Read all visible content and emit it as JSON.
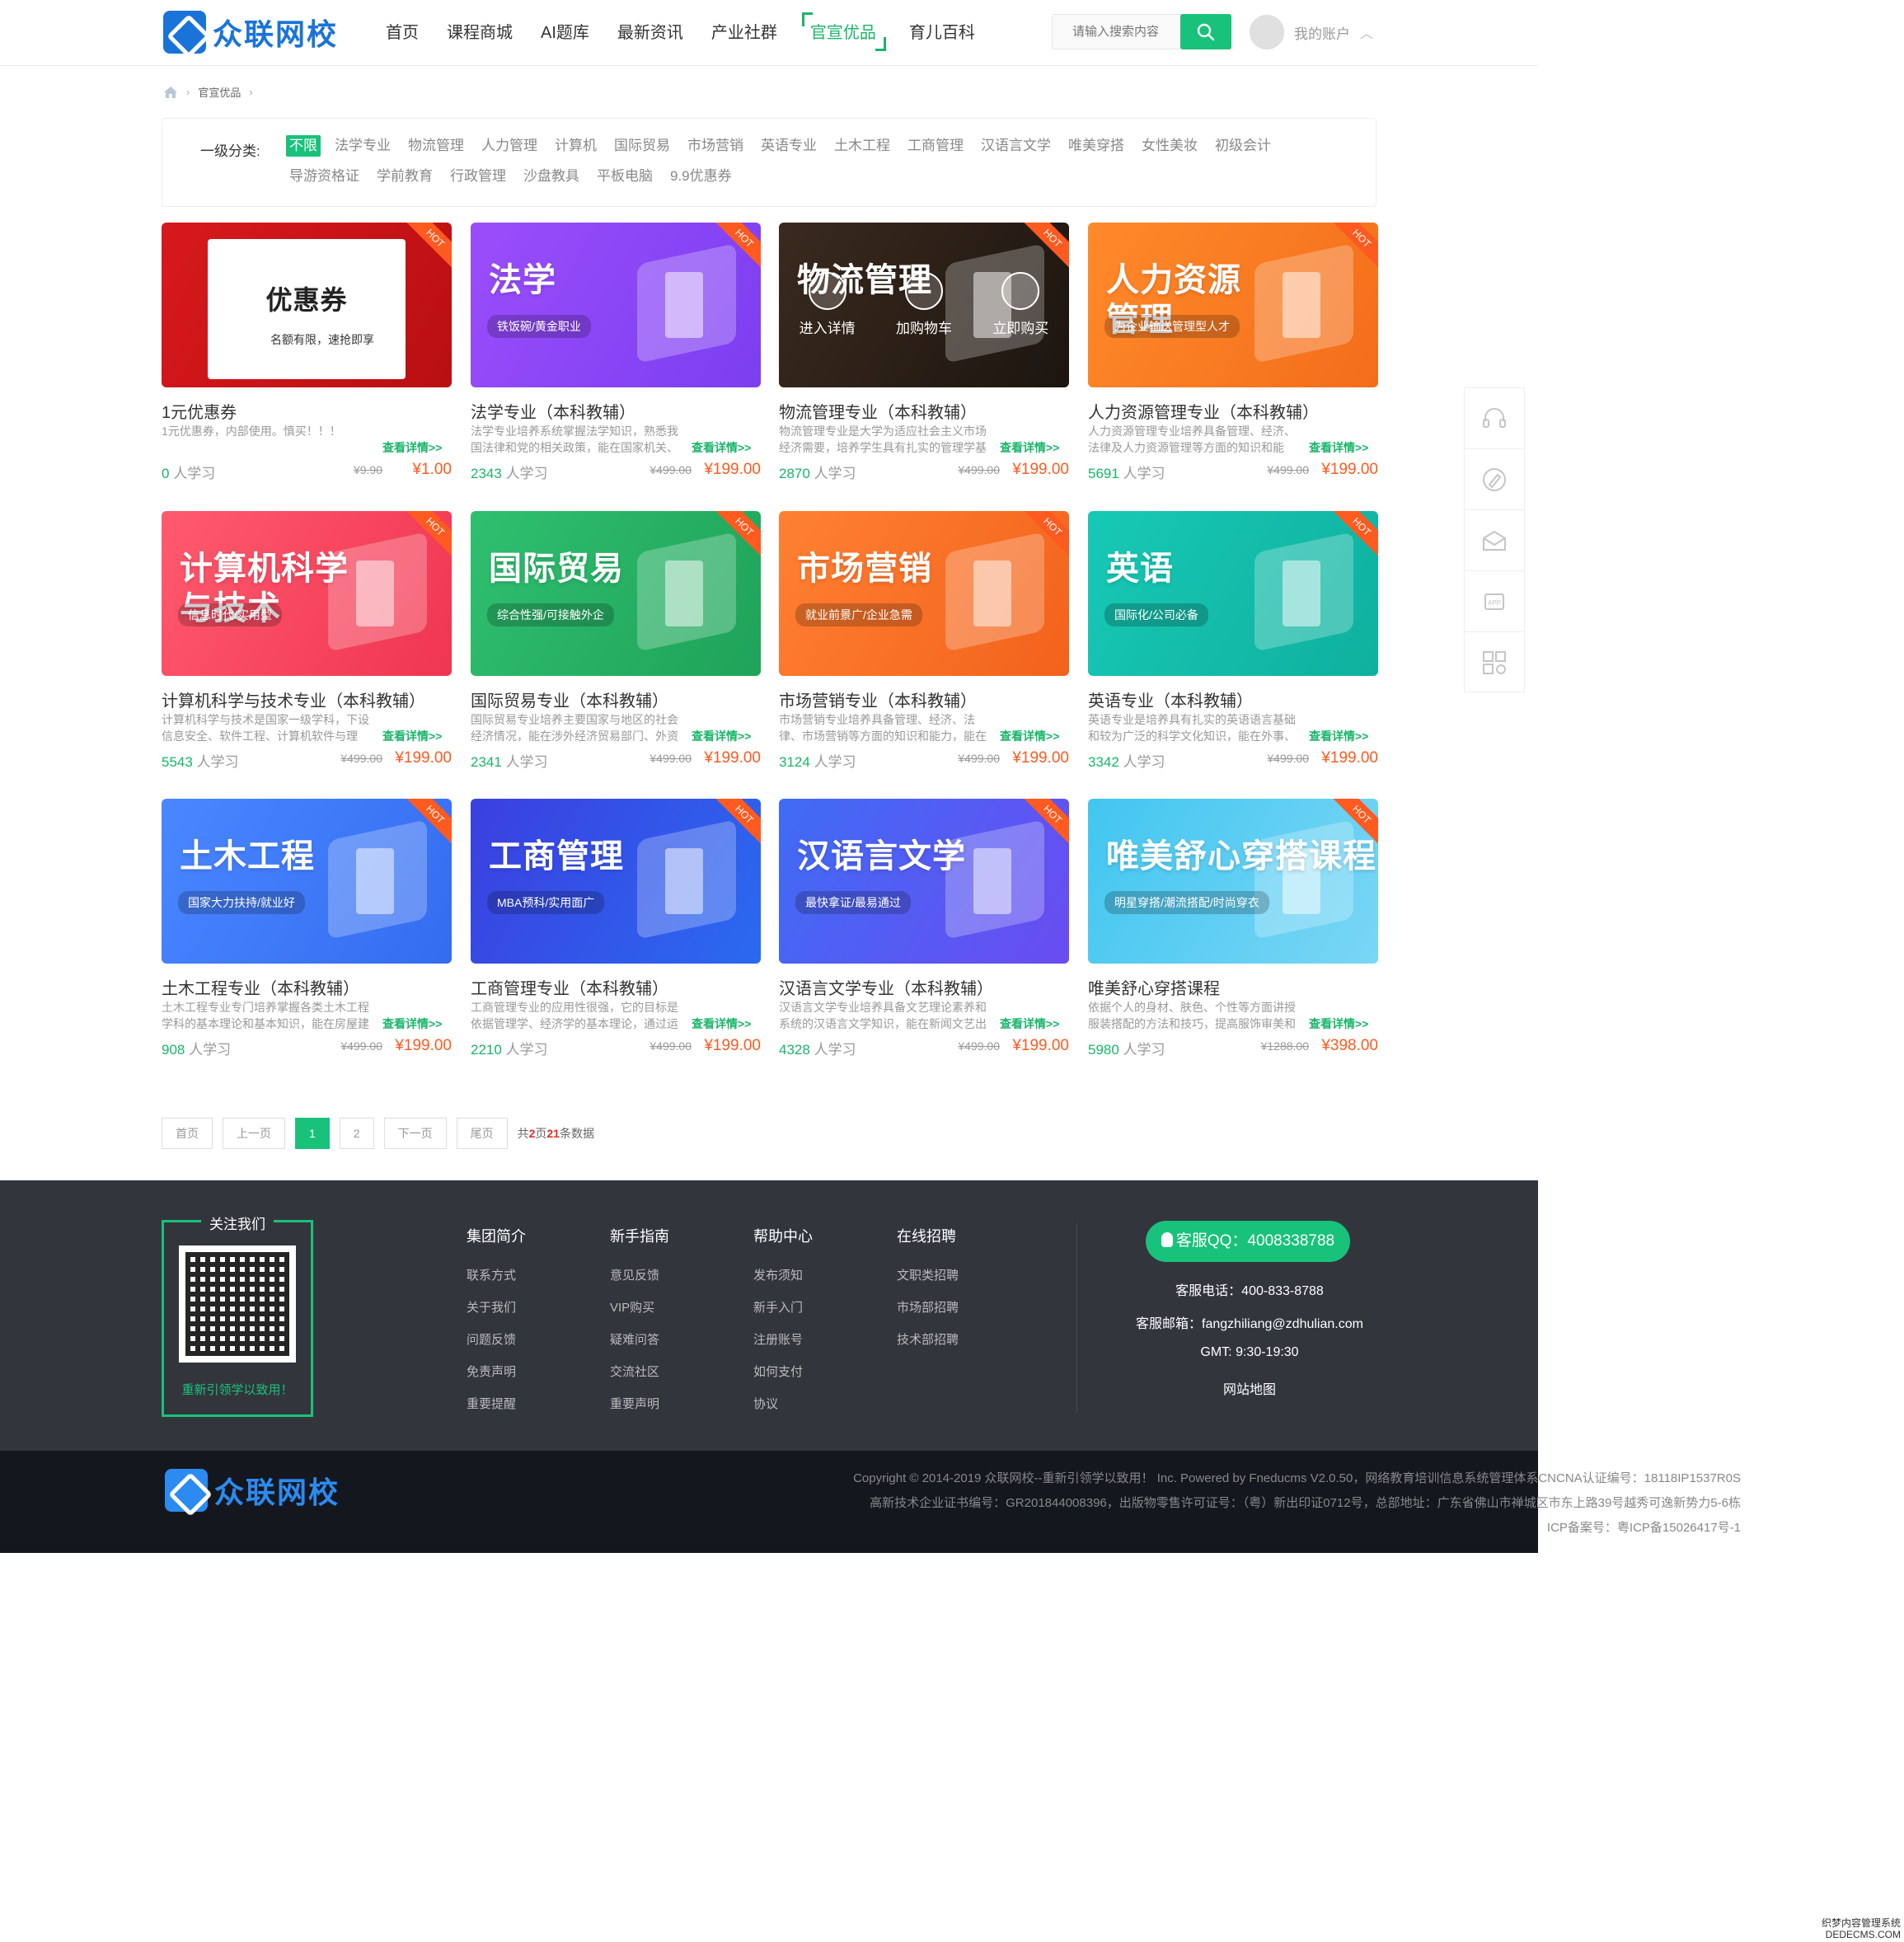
{
  "header": {
    "logo_text": "众联网校",
    "nav": [
      "首页",
      "课程商城",
      "AI题库",
      "最新资讯",
      "产业社群",
      "官宣优品",
      "育儿百科"
    ],
    "search_placeholder": "请输入搜索内容",
    "account_label": "我的账户"
  },
  "breadcrumb": {
    "current": "官宣优品"
  },
  "filter": {
    "label": "一级分类:",
    "tags": [
      "不限",
      "法学专业",
      "物流管理",
      "人力管理",
      "计算机",
      "国际贸易",
      "市场营销",
      "英语专业",
      "土木工程",
      "工商管理",
      "汉语言文学",
      "唯美穿搭",
      "女性美妆",
      "初级会计",
      "导游资格证",
      "学前教育",
      "行政管理",
      "沙盘教具",
      "平板电脑",
      "9.9优惠券"
    ]
  },
  "courses": [
    {
      "thumb_title": "优惠券",
      "thumb_sub": "名额有限，速抢即享",
      "name": "1元优惠券",
      "desc": "1元优惠券，内部使用。慎买！！！",
      "more": "查看详情>>",
      "count": "0",
      "unit": "人学习",
      "old": "¥9.90",
      "price": "¥1.00",
      "color1": "#d7191c",
      "color2": "#b90f12"
    },
    {
      "thumb_title": "法学",
      "thumb_sub": "铁饭碗/黄金职业",
      "name": "法学专业（本科教辅）",
      "desc": "法学专业培养系统掌握法学知识，熟悉我国法律和党的相关政策，能在国家机关、企事业单",
      "more": "查看详情>>",
      "count": "2343",
      "unit": "人学习",
      "old": "¥499.00",
      "price": "¥199.00",
      "color1": "#9b4dfb",
      "color2": "#7b3ff0"
    },
    {
      "thumb_title": "物流管理",
      "thumb_sub": "",
      "name": "物流管理专业（本科教辅）",
      "desc": "物流管理专业是大学为适应社会主义市场经济需要，培养学生具有扎实的管理学基础、经济",
      "more": "查看详情>>",
      "count": "2870",
      "unit": "人学习",
      "old": "¥499.00",
      "price": "¥199.00",
      "color1": "#3a2a1e",
      "color2": "#1c1510",
      "overlay": [
        "进入详情",
        "加购物车",
        "立即购买"
      ]
    },
    {
      "thumb_title": "人力资源\n管理",
      "thumb_sub": "为企业输送管理型人才",
      "name": "人力资源管理专业（本科教辅）",
      "desc": "人力资源管理专业培养具备管理、经济、法律及人力资源管理等方面的知识和能力，能在事",
      "more": "查看详情>>",
      "count": "5691",
      "unit": "人学习",
      "old": "¥499.00",
      "price": "¥199.00",
      "color1": "#ff8a2a",
      "color2": "#f36d1b"
    },
    {
      "thumb_title": "计算机科学\n与技术",
      "thumb_sub": "信息时代/实用型",
      "name": "计算机科学与技术专业（本科教辅）",
      "desc": "计算机科学与技术是国家一级学科，下设信息安全、软件工程、计算机软件与理论、计算机",
      "more": "查看详情>>",
      "count": "5543",
      "unit": "人学习",
      "old": "¥499.00",
      "price": "¥199.00",
      "color1": "#ff5a6e",
      "color2": "#f03550"
    },
    {
      "thumb_title": "国际贸易",
      "thumb_sub": "综合性强/可接触外企",
      "name": "国际贸易专业（本科教辅）",
      "desc": "国际贸易专业培养主要国家与地区的社会经济情况，能在涉外经济贸易部门、外资企业及政",
      "more": "查看详情>>",
      "count": "2341",
      "unit": "人学习",
      "old": "¥499.00",
      "price": "¥199.00",
      "color1": "#2fbf6f",
      "color2": "#1fa35a"
    },
    {
      "thumb_title": "市场营销",
      "thumb_sub": "就业前景广/企业急需",
      "name": "市场营销专业（本科教辅）",
      "desc": "市场营销专业培养具备管理、经济、法律、市场营销等方面的知识和能力，能在企、事业单",
      "more": "查看详情>>",
      "count": "3124",
      "unit": "人学习",
      "old": "¥499.00",
      "price": "¥199.00",
      "color1": "#ff8032",
      "color2": "#f2621c"
    },
    {
      "thumb_title": "英语",
      "thumb_sub": "国际化/公司必备",
      "name": "英语专业（本科教辅）",
      "desc": "英语专业是培养具有扎实的英语语言基础和较为广泛的科学文化知识，能在外事、经贸、文",
      "more": "查看详情>>",
      "count": "3342",
      "unit": "人学习",
      "old": "¥499.00",
      "price": "¥199.00",
      "color1": "#17c9b5",
      "color2": "#0fb09e"
    },
    {
      "thumb_title": "土木工程",
      "thumb_sub": "国家大力扶持/就业好",
      "name": "土木工程专业（本科教辅）",
      "desc": "土木工程专业专门培养掌握各类土木工程学科的基本理论和基本知识，能在房屋建筑、地下",
      "more": "查看详情>>",
      "count": "908",
      "unit": "人学习",
      "old": "¥499.00",
      "price": "¥199.00",
      "color1": "#4a87ff",
      "color2": "#346cf0"
    },
    {
      "thumb_title": "工商管理",
      "thumb_sub": "MBA预科/实用面广",
      "name": "工商管理专业（本科教辅）",
      "desc": "工商管理专业的应用性很强，它的目标是依据管理学、经济学的基本理论，通过运用现代",
      "more": "查看详情>>",
      "count": "2210",
      "unit": "人学习",
      "old": "¥499.00",
      "price": "¥199.00",
      "color1": "#3b3fe0",
      "color2": "#2a6af0"
    },
    {
      "thumb_title": "汉语言文学",
      "thumb_sub": "最快拿证/最易通过",
      "name": "汉语言文学专业（本科教辅）",
      "desc": "汉语言文学专业培养具备文艺理论素养和系统的汉语言文学知识，能在新闻文艺出版部门、",
      "more": "查看详情>>",
      "count": "4328",
      "unit": "人学习",
      "old": "¥499.00",
      "price": "¥199.00",
      "color1": "#3f6cf5",
      "color2": "#6a4cf0"
    },
    {
      "thumb_title": "唯美舒心穿搭课程",
      "thumb_sub": "明星穿搭/潮流搭配/时尚穿衣",
      "name": "唯美舒心穿搭课程",
      "desc": "依据个人的身材、肤色、个性等方面讲授服装搭配的方法和技巧，提高服饰审美和穿着搭配",
      "more": "查看详情>>",
      "count": "5980",
      "unit": "人学习",
      "old": "¥1288.00",
      "price": "¥398.00",
      "color1": "#42c6f0",
      "color2": "#7ad6f5"
    }
  ],
  "hot_label": "HOT",
  "pager": {
    "first": "首页",
    "prev": "上一页",
    "pages": [
      "1",
      "2"
    ],
    "next": "下一页",
    "last": "尾页",
    "info_pre": "共",
    "total_pages": "2",
    "info_mid": "页",
    "total_items": "21",
    "info_post": "条数据"
  },
  "footer": {
    "follow_title": "关注我们",
    "follow_slogan": "重新引领学以致用！",
    "columns": [
      {
        "title": "集团简介",
        "items": [
          "联系方式",
          "关于我们",
          "问题反馈",
          "免责声明",
          "重要提醒"
        ]
      },
      {
        "title": "新手指南",
        "items": [
          "意见反馈",
          "VIP购买",
          "疑难问答",
          "交流社区",
          "重要声明"
        ]
      },
      {
        "title": "帮助中心",
        "items": [
          "发布须知",
          "新手入门",
          "注册账号",
          "如何支付",
          "协议"
        ]
      },
      {
        "title": "在线招聘",
        "items": [
          "文职类招聘",
          "市场部招聘",
          "技术部招聘"
        ]
      }
    ],
    "qq": "客服QQ：4008338788",
    "phone": "客服电话：400-833-8788",
    "email": "客服邮箱：fangzhiliang@zdhulian.com",
    "gmt": "GMT: 9:30-19:30",
    "sitemap": "网站地图",
    "copyright1": "Copyright © 2014-2019 众联网校--重新引领学以致用！ Inc. Powered by Fneducms V2.0.50，网络教育培训信息系统管理体系CNCNA认证编号：18118IP1537R0S",
    "copyright2": "高新技术企业证书编号：GR201844008396，出版物零售许可证号：（粤）新出印证0712号，总部地址：广东省佛山市禅城区市东上路39号越秀可逸新势力5-6栋",
    "copyright3": "ICP备案号：粤ICP备15026417号-1",
    "logo_text": "众联网校"
  },
  "watermark": [
    "织梦内容管理系统",
    "DEDECMS.COM"
  ]
}
